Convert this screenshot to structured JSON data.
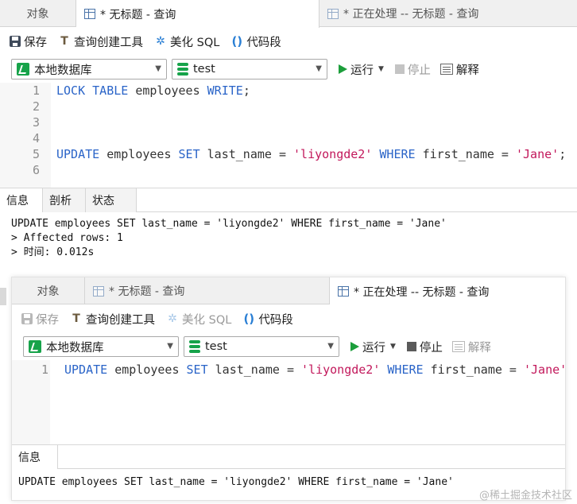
{
  "top": {
    "tabs": [
      {
        "label": "对象"
      },
      {
        "label": "* 无标题 - 查询"
      },
      {
        "label": "* 正在处理 -- 无标题 - 查询"
      }
    ],
    "toolbar": {
      "save": "保存",
      "query_builder": "查询创建工具",
      "beautify": "美化 SQL",
      "snippet": "代码段"
    },
    "connection": "本地数据库",
    "database": "test",
    "run": "运行",
    "stop": "停止",
    "explain": "解释",
    "editor": {
      "line_numbers": [
        "1",
        "2",
        "3",
        "4",
        "5",
        "6"
      ],
      "line1": {
        "kw1": "LOCK",
        "kw2": "TABLE",
        "ident": "employees",
        "kw3": "WRITE",
        "end": ";"
      },
      "line5": {
        "kw1": "UPDATE",
        "ident1": "employees",
        "kw2": "SET",
        "ident2": "last_name =",
        "str1": "'liyongde2'",
        "kw3": "WHERE",
        "ident3": "first_name =",
        "str2": "'Jane'",
        "end": ";"
      }
    },
    "result_tabs": [
      {
        "label": "信息"
      },
      {
        "label": "剖析"
      },
      {
        "label": "状态"
      }
    ],
    "output": [
      "UPDATE employees SET last_name = 'liyongde2' WHERE first_name = 'Jane'",
      "> Affected rows: 1",
      "> 时间: 0.012s"
    ]
  },
  "bottom": {
    "tabs": [
      {
        "label": "对象"
      },
      {
        "label": "* 无标题 - 查询"
      },
      {
        "label": "* 正在处理 -- 无标题 - 查询"
      }
    ],
    "toolbar": {
      "save": "保存",
      "query_builder": "查询创建工具",
      "beautify": "美化 SQL",
      "snippet": "代码段"
    },
    "connection": "本地数据库",
    "database": "test",
    "run": "运行",
    "stop": "停止",
    "explain": "解释",
    "editor": {
      "line_numbers": [
        "1"
      ],
      "line1": {
        "kw1": "UPDATE",
        "ident1": "employees",
        "kw2": "SET",
        "ident2": "last_name =",
        "str1": "'liyongde2'",
        "kw3": "WHERE",
        "ident3": "first_name =",
        "str2": "'Jane'"
      }
    },
    "result_tabs": [
      {
        "label": "信息"
      }
    ],
    "output": [
      "UPDATE employees SET last_name = 'liyongde2' WHERE first_name = 'Jane'"
    ]
  },
  "watermark": "@稀土掘金技术社区",
  "colors": {
    "keyword": "#2a64c8",
    "string": "#c2185b",
    "run_green": "#1c9e3b",
    "db_green": "#17a34a"
  }
}
